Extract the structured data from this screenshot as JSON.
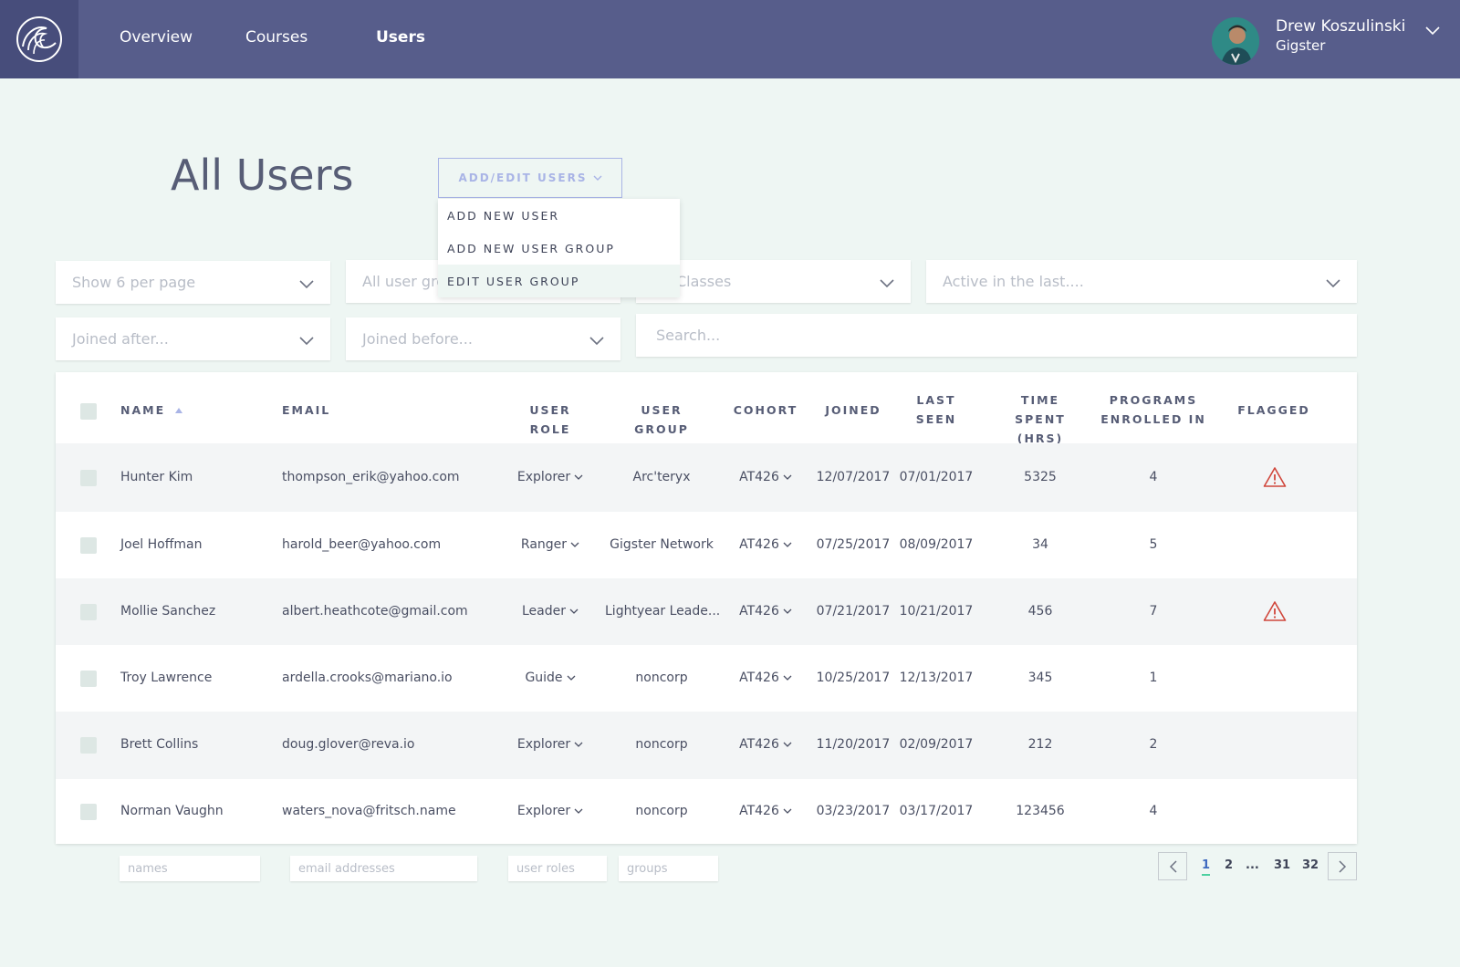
{
  "nav": {
    "items": [
      {
        "label": "Overview"
      },
      {
        "label": "Courses"
      },
      {
        "label": "Users"
      }
    ],
    "user": {
      "name": "Drew Koszulinski",
      "org": "Gigster"
    }
  },
  "header": {
    "title": "All Users",
    "add_edit_label": "ADD/EDIT USERS",
    "menu": [
      {
        "label": "ADD NEW USER"
      },
      {
        "label": "ADD NEW USER GROUP"
      },
      {
        "label": "EDIT USER GROUP"
      }
    ]
  },
  "filters": {
    "per_page": "Show 6 per page",
    "user_groups": "All user groups",
    "classes": "Classes",
    "active": "Active in the last....",
    "joined_after": "Joined after...",
    "joined_before": "Joined before...",
    "search_placeholder": "Search..."
  },
  "table": {
    "headers": {
      "name": "NAME",
      "email": "EMAIL",
      "role": "USER ROLE",
      "group": "USER GROUP",
      "cohort": "COHORT",
      "joined": "JOINED",
      "last_seen_1": "LAST",
      "last_seen_2": "SEEN",
      "time_1": "TIME SPENT",
      "time_2": "(HRS)",
      "programs_1": "PROGRAMS",
      "programs_2": "ENROLLED IN",
      "flagged": "FLAGGED"
    },
    "rows": [
      {
        "name": "Hunter Kim",
        "email": "thompson_erik@yahoo.com",
        "role": "Explorer",
        "group": "Arc'teryx",
        "cohort": "AT426",
        "joined": "12/07/2017",
        "last_seen": "07/01/2017",
        "time": "5325",
        "programs": "4",
        "flagged": true
      },
      {
        "name": "Joel Hoffman",
        "email": "harold_beer@yahoo.com",
        "role": "Ranger",
        "group": "Gigster Network",
        "cohort": "AT426",
        "joined": "07/25/2017",
        "last_seen": "08/09/2017",
        "time": "34",
        "programs": "5",
        "flagged": false
      },
      {
        "name": "Mollie Sanchez",
        "email": "albert.heathcote@gmail.com",
        "role": "Leader",
        "group": "Lightyear Leade...",
        "cohort": "AT426",
        "joined": "07/21/2017",
        "last_seen": "10/21/2017",
        "time": "456",
        "programs": "7",
        "flagged": true
      },
      {
        "name": "Troy Lawrence",
        "email": "ardella.crooks@mariano.io",
        "role": "Guide",
        "group": "noncorp",
        "cohort": "AT426",
        "joined": "10/25/2017",
        "last_seen": "12/13/2017",
        "time": "345",
        "programs": "1",
        "flagged": false
      },
      {
        "name": "Brett Collins",
        "email": "doug.glover@reva.io",
        "role": "Explorer",
        "group": "noncorp",
        "cohort": "AT426",
        "joined": "11/20/2017",
        "last_seen": "02/09/2017",
        "time": "212",
        "programs": "2",
        "flagged": false
      },
      {
        "name": "Norman Vaughn",
        "email": "waters_nova@fritsch.name",
        "role": "Explorer",
        "group": "noncorp",
        "cohort": "AT426",
        "joined": "03/23/2017",
        "last_seen": "03/17/2017",
        "time": "123456",
        "programs": "4",
        "flagged": false
      }
    ]
  },
  "footer": {
    "names": "names",
    "emails": "email addresses",
    "roles": "user roles",
    "groups": "groups",
    "pages": [
      "1",
      "2",
      "...",
      "31",
      "32"
    ]
  },
  "colors": {
    "topbar": "#575d8b",
    "logo_bg": "#474d7b",
    "background": "#eef6f3",
    "accent": "#a9b4e6",
    "flag": "#d0463b",
    "current_page_underline": "#4dd0a0"
  }
}
